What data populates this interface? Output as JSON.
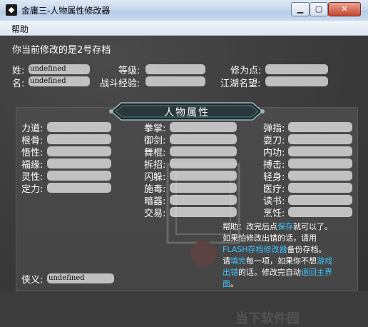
{
  "window": {
    "title": "金庸三-人物属性修改器",
    "min": "0",
    "max": "1",
    "close": "r"
  },
  "menu": {
    "help": "帮助"
  },
  "header": {
    "current_save": "你当前修改的是2号存档"
  },
  "top_fields": {
    "name_surname_label": "姓:",
    "name_surname_value": "undefined",
    "name_given_label": "名:",
    "name_given_value": "undefined",
    "level_label": "等级:",
    "exp_label": "战斗经验:",
    "points_label": "修为点:",
    "fame_label": "江湖名望:"
  },
  "panel": {
    "title": "人物属性",
    "left_stats": [
      "力道:",
      "根骨:",
      "悟性:",
      "福缘:",
      "灵性:",
      "定力:"
    ],
    "mid_stats": [
      "拳掌:",
      "御剑:",
      "舞棍:",
      "拆招:",
      "闪躲:",
      "施毒:",
      "暗器:",
      "交易:"
    ],
    "right_stats": [
      "弹指:",
      "耍刀:",
      "内功:",
      "搏击:",
      "轻身:",
      "医疗:",
      "读书:",
      "烹饪:"
    ],
    "chivalry_label": "侠义:",
    "chivalry_value": "undefined"
  },
  "help": {
    "p1a": "帮助：改完后点",
    "p1link": "保存",
    "p1b": "就可以了。",
    "p2": "如果怕修改出错的话，请用",
    "p3link": "FLASH存档修改器",
    "p3b": "备份存档。",
    "p4a": "请",
    "p4link1": "填完",
    "p4b": "每一项，如果你不想",
    "p4link2": "游戏",
    "p5link1": "出错",
    "p5b": "的话。修改完自动",
    "p5link2": "退回主界",
    "p6link": "面",
    "p6b": "。"
  },
  "watermark_text": "当下软件园",
  "colors": {
    "link": "#3fc3ff",
    "bg": "#3c3c3c",
    "field": "#dcdcdc"
  }
}
